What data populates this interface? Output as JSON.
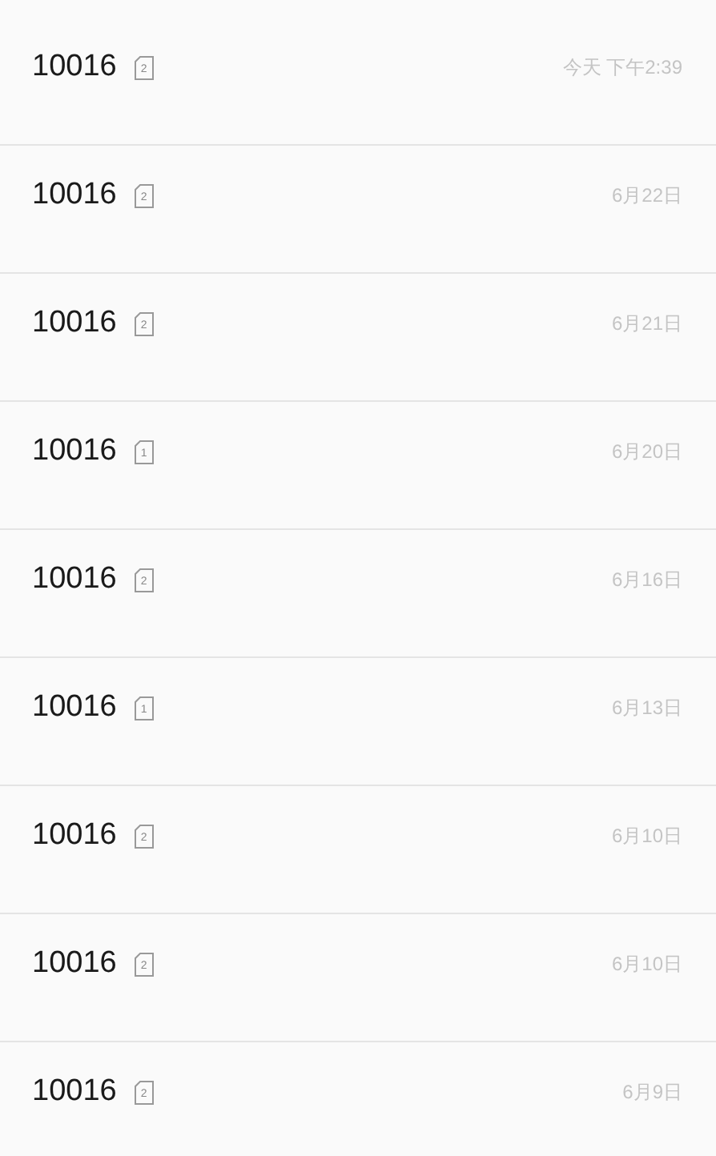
{
  "conversations": [
    {
      "sender": "10016",
      "sim": "2",
      "time": "今天 下午2:39"
    },
    {
      "sender": "10016",
      "sim": "2",
      "time": "6月22日"
    },
    {
      "sender": "10016",
      "sim": "2",
      "time": "6月21日"
    },
    {
      "sender": "10016",
      "sim": "1",
      "time": "6月20日"
    },
    {
      "sender": "10016",
      "sim": "2",
      "time": "6月16日"
    },
    {
      "sender": "10016",
      "sim": "1",
      "time": "6月13日"
    },
    {
      "sender": "10016",
      "sim": "2",
      "time": "6月10日"
    },
    {
      "sender": "10016",
      "sim": "2",
      "time": "6月10日"
    },
    {
      "sender": "10016",
      "sim": "2",
      "time": "6月9日"
    }
  ]
}
